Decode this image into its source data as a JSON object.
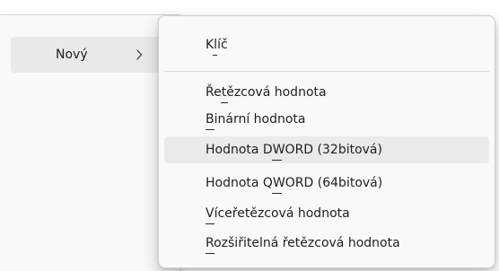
{
  "parent_menu": {
    "new_item": {
      "label": "Nový",
      "icon": "chevron-right-icon"
    }
  },
  "submenu": {
    "items": [
      {
        "label": "Klíč"
      },
      {
        "label": "Řetězcová hodnota"
      },
      {
        "label": "Binární hodnota"
      },
      {
        "label": "Hodnota DWORD (32bitová)"
      },
      {
        "label": "Hodnota QWORD (64bitová)"
      },
      {
        "label": "Víceřetězcová hodnota"
      },
      {
        "label": "Rozšiřitelná řetězcová hodnota"
      }
    ]
  },
  "colors": {
    "menu_background": "#f9f9f9",
    "highlight": "#eaeaea",
    "text": "#1f1f1f"
  }
}
